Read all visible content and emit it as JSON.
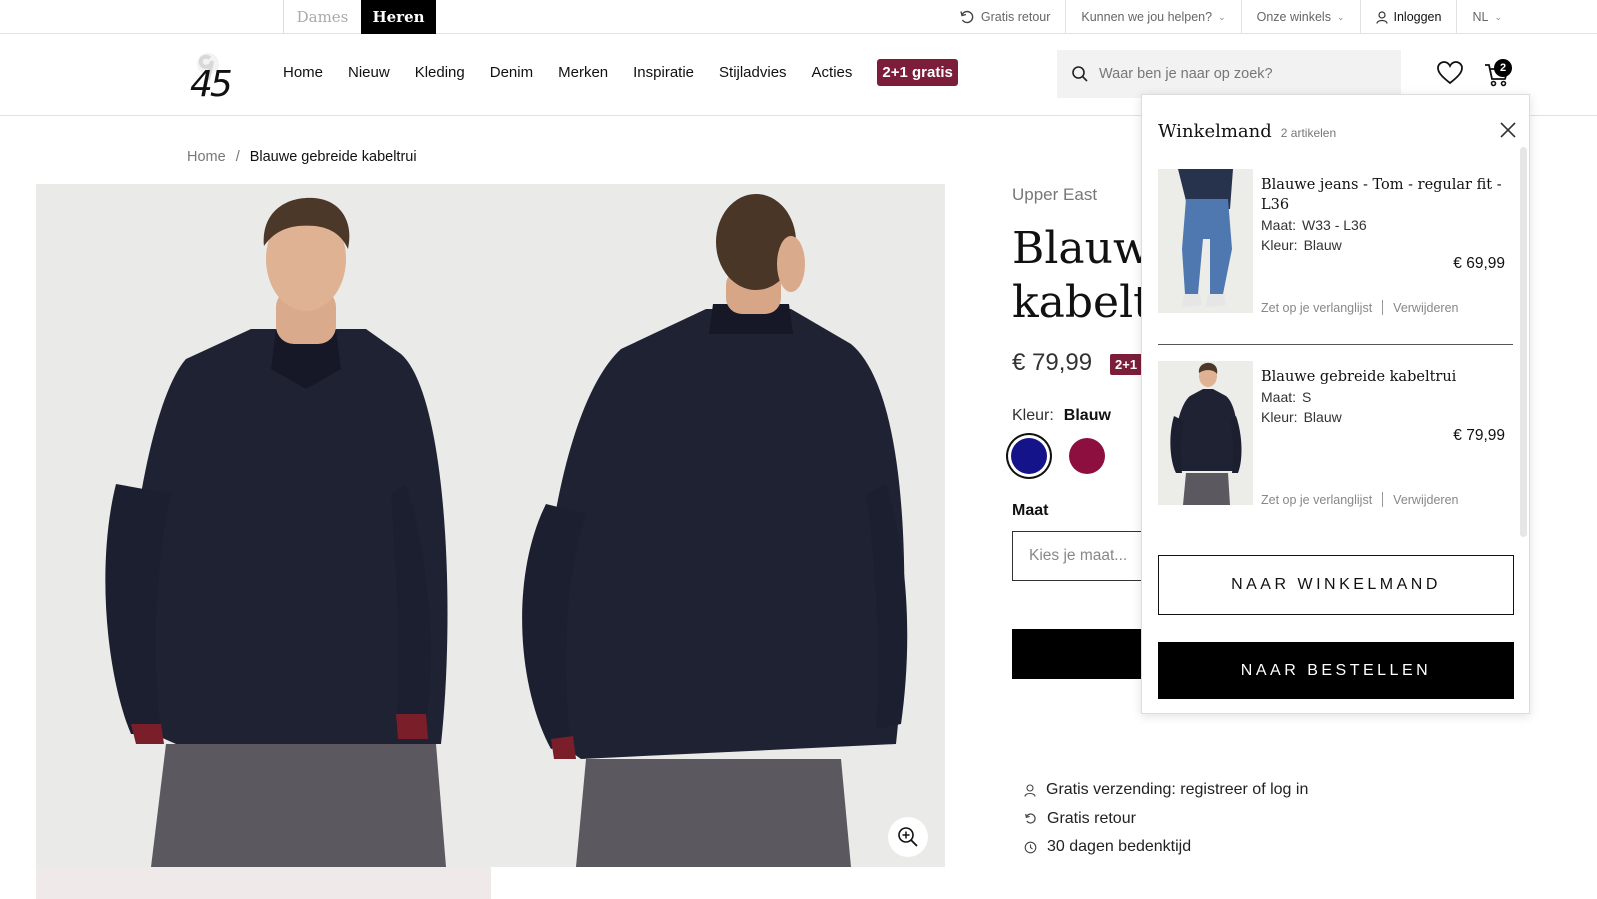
{
  "topbar": {
    "gender_tabs": [
      {
        "label": "Dames",
        "active": false
      },
      {
        "label": "Heren",
        "active": true
      }
    ],
    "utilities": {
      "returns": "Gratis retour",
      "help": "Kunnen we jou helpen?",
      "stores": "Onze winkels",
      "login": "Inloggen",
      "language": "NL"
    }
  },
  "header": {
    "nav": [
      "Home",
      "Nieuw",
      "Kleding",
      "Denim",
      "Merken",
      "Inspiratie",
      "Stijladvies",
      "Acties"
    ],
    "promo": "2+1 gratis",
    "search_placeholder": "Waar ben je naar op zoek?",
    "cart_count": "2",
    "promo_color": "#7c1d3a"
  },
  "breadcrumb": {
    "home": "Home",
    "separator": "/",
    "current": "Blauwe gebreide kabeltrui"
  },
  "product": {
    "brand": "Upper East",
    "title_line1": "Blauwe",
    "title_line2": "kabeltr",
    "price": "€ 79,99",
    "badge": "2+1",
    "color_label": "Kleur:",
    "color_value": "Blauw",
    "swatches": [
      {
        "name": "Blauw",
        "color": "#14138a",
        "selected": true
      },
      {
        "name": "Rood",
        "color": "#8c0f3f",
        "selected": false
      }
    ],
    "size_label": "Maat",
    "size_placeholder": "Kies je maat...",
    "usps": [
      {
        "icon": "user-icon",
        "text": "Gratis verzending: registreer of log in"
      },
      {
        "icon": "return-icon",
        "text": "Gratis retour"
      },
      {
        "icon": "clock-icon",
        "text": "30 dagen bedenktijd"
      }
    ]
  },
  "cart": {
    "title": "Winkelmand",
    "count": "2 artikelen",
    "items": [
      {
        "name": "Blauwe jeans - Tom - regular fit - L36",
        "size_label": "Maat:",
        "size": "W33 - L36",
        "color_label": "Kleur:",
        "color": "Blauw",
        "price": "€ 69,99",
        "wishlist": "Zet op je verlanglijst",
        "remove": "Verwijderen"
      },
      {
        "name": "Blauwe gebreide kabeltrui",
        "size_label": "Maat:",
        "size": "S",
        "color_label": "Kleur:",
        "color": "Blauw",
        "price": "€ 79,99",
        "wishlist": "Zet op je verlanglijst",
        "remove": "Verwijderen"
      }
    ],
    "view_cart": "NAAR WINKELMAND",
    "checkout": "NAAR BESTELLEN"
  }
}
